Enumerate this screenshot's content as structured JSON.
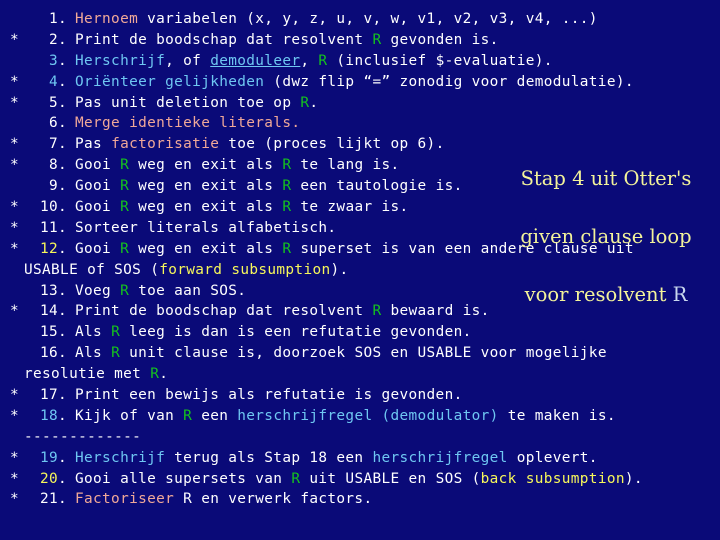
{
  "slide": {
    "background_color": "#0a0a78",
    "colors": {
      "white": "#ffffff",
      "green": "#14c21e",
      "blue": "#6fc7f2",
      "salmon": "#f0a898",
      "yellow": "#f7f75a",
      "annotation": "#f3f39a"
    }
  },
  "annotation": {
    "line1": "Stap 4 uit Otter's",
    "line2": "given clause loop",
    "line3": "voor resolvent ",
    "r": "R"
  },
  "steps": [
    {
      "mark": "",
      "number": "1",
      "dot": ".",
      "num_color": "w",
      "parts": [
        {
          "t": "",
          "c": "w"
        },
        {
          "t": "Hernoem",
          "c": "s"
        },
        {
          "t": " variabelen (x, y, z, u, v, w, v1, v2, v3, v4, ...)",
          "c": "w"
        }
      ]
    },
    {
      "mark": "*",
      "number": "2",
      "dot": ".",
      "num_color": "w",
      "parts": [
        {
          "t": "Print de boodschap dat resolvent ",
          "c": "w"
        },
        {
          "t": "R",
          "c": "g"
        },
        {
          "t": " gevonden is.",
          "c": "w"
        }
      ]
    },
    {
      "mark": "",
      "number": "3",
      "dot": ".",
      "num_color": "b",
      "parts": [
        {
          "t": "Herschrijf",
          "c": "b"
        },
        {
          "t": ", of ",
          "c": "w"
        },
        {
          "t": "demoduleer",
          "c": "b",
          "u": true
        },
        {
          "t": ", ",
          "c": "w"
        },
        {
          "t": "R",
          "c": "g"
        },
        {
          "t": " (inclusief $-evaluatie).",
          "c": "w"
        }
      ]
    },
    {
      "mark": "*",
      "number": "4",
      "dot": ".",
      "num_color": "b",
      "parts": [
        {
          "t": "Oriënteer gelijkheden",
          "c": "b"
        },
        {
          "t": " (dwz flip “=” zonodig voor demodulatie).",
          "c": "w"
        }
      ]
    },
    {
      "mark": "*",
      "number": "5",
      "dot": ".",
      "num_color": "w",
      "parts": [
        {
          "t": "Pas unit deletion toe op ",
          "c": "w"
        },
        {
          "t": "R",
          "c": "g"
        },
        {
          "t": ".",
          "c": "w"
        }
      ]
    },
    {
      "mark": "",
      "number": "6",
      "dot": ".",
      "num_color": "w",
      "parts": [
        {
          "t": "Merge identieke literals.",
          "c": "s"
        }
      ]
    },
    {
      "mark": "*",
      "number": "7",
      "dot": ".",
      "num_color": "w",
      "parts": [
        {
          "t": "Pas ",
          "c": "w"
        },
        {
          "t": "factorisatie",
          "c": "s"
        },
        {
          "t": " toe (proces lijkt op 6).",
          "c": "w"
        }
      ]
    },
    {
      "mark": "*",
      "number": "8",
      "dot": ".",
      "num_color": "w",
      "parts": [
        {
          "t": "Gooi ",
          "c": "w"
        },
        {
          "t": "R",
          "c": "g"
        },
        {
          "t": " weg en exit als ",
          "c": "w"
        },
        {
          "t": "R",
          "c": "g"
        },
        {
          "t": " te lang is.",
          "c": "w"
        }
      ]
    },
    {
      "mark": "",
      "number": "9",
      "dot": ".",
      "num_color": "w",
      "parts": [
        {
          "t": "Gooi ",
          "c": "w"
        },
        {
          "t": "R",
          "c": "g"
        },
        {
          "t": " weg en exit als ",
          "c": "w"
        },
        {
          "t": "R",
          "c": "g"
        },
        {
          "t": " een tautologie is.",
          "c": "w"
        }
      ]
    },
    {
      "mark": "*",
      "number": "10",
      "dot": ".",
      "num_color": "w",
      "parts": [
        {
          "t": "Gooi ",
          "c": "w"
        },
        {
          "t": "R",
          "c": "g"
        },
        {
          "t": " weg en exit als ",
          "c": "w"
        },
        {
          "t": "R",
          "c": "g"
        },
        {
          "t": " te zwaar is.",
          "c": "w"
        }
      ]
    },
    {
      "mark": "*",
      "number": "11",
      "dot": ".",
      "num_color": "w",
      "parts": [
        {
          "t": "Sorteer literals alfabetisch.",
          "c": "w"
        }
      ]
    },
    {
      "mark": "*",
      "number": "12",
      "dot": ".",
      "num_color": "y",
      "parts": [
        {
          "t": "Gooi ",
          "c": "w"
        },
        {
          "t": "R",
          "c": "g"
        },
        {
          "t": " weg en exit als ",
          "c": "w"
        },
        {
          "t": "R",
          "c": "g"
        },
        {
          "t": " superset is van een andere clause uit",
          "c": "w"
        }
      ]
    },
    {
      "continuation": true,
      "parts": [
        {
          "t": "USABLE of SOS (",
          "c": "w"
        },
        {
          "t": "forward subsumption",
          "c": "y"
        },
        {
          "t": ").",
          "c": "w"
        }
      ]
    },
    {
      "mark": "",
      "number": "13",
      "dot": ".",
      "num_color": "w",
      "parts": [
        {
          "t": "Voeg ",
          "c": "w"
        },
        {
          "t": "R",
          "c": "g"
        },
        {
          "t": " toe aan SOS.",
          "c": "w"
        }
      ]
    },
    {
      "mark": "*",
      "number": "14",
      "dot": ".",
      "num_color": "w",
      "parts": [
        {
          "t": "Print de boodschap dat resolvent ",
          "c": "w"
        },
        {
          "t": "R",
          "c": "g"
        },
        {
          "t": " bewaard is.",
          "c": "w"
        }
      ]
    },
    {
      "mark": "",
      "number": "15",
      "dot": ".",
      "num_color": "w",
      "parts": [
        {
          "t": "Als ",
          "c": "w"
        },
        {
          "t": "R",
          "c": "g"
        },
        {
          "t": " leeg is dan is een refutatie gevonden.",
          "c": "w"
        }
      ]
    },
    {
      "mark": "",
      "number": "16",
      "dot": ".",
      "num_color": "w",
      "parts": [
        {
          "t": "Als ",
          "c": "w"
        },
        {
          "t": "R",
          "c": "g"
        },
        {
          "t": " unit clause is, doorzoek SOS en USABLE voor mogelijke",
          "c": "w"
        }
      ]
    },
    {
      "continuation": true,
      "parts": [
        {
          "t": "resolutie met ",
          "c": "w"
        },
        {
          "t": "R",
          "c": "g"
        },
        {
          "t": ".",
          "c": "w"
        }
      ]
    },
    {
      "mark": "*",
      "number": "17",
      "dot": ".",
      "num_color": "w",
      "parts": [
        {
          "t": "Print een bewijs als refutatie is gevonden.",
          "c": "w"
        }
      ]
    },
    {
      "mark": "*",
      "number": "18",
      "dot": ".",
      "num_color": "b",
      "parts": [
        {
          "t": "Kijk of van ",
          "c": "w"
        },
        {
          "t": "R",
          "c": "g"
        },
        {
          "t": " een ",
          "c": "w"
        },
        {
          "t": "herschrijfregel",
          "c": "b"
        },
        {
          "t": " ",
          "c": "w"
        },
        {
          "t": "(demodulator)",
          "c": "b"
        },
        {
          "t": " te maken is.",
          "c": "w"
        }
      ]
    },
    {
      "continuation": true,
      "parts": [
        {
          "t": "-------------",
          "c": "w"
        }
      ]
    },
    {
      "mark": "*",
      "number": "19",
      "dot": ".",
      "num_color": "b",
      "parts": [
        {
          "t": "Herschrijf",
          "c": "b"
        },
        {
          "t": " terug als Stap 18 een ",
          "c": "w"
        },
        {
          "t": "herschrijfregel",
          "c": "b"
        },
        {
          "t": " oplevert.",
          "c": "w"
        }
      ]
    },
    {
      "mark": "*",
      "number": "20",
      "dot": ".",
      "num_color": "y",
      "parts": [
        {
          "t": "Gooi alle supersets van ",
          "c": "w"
        },
        {
          "t": "R",
          "c": "g"
        },
        {
          "t": " uit USABLE en SOS (",
          "c": "w"
        },
        {
          "t": "back subsumption",
          "c": "y"
        },
        {
          "t": ").",
          "c": "w"
        }
      ]
    },
    {
      "mark": "*",
      "number": "21",
      "dot": ".",
      "num_color": "w",
      "parts": [
        {
          "t": "Factoriseer",
          "c": "s"
        },
        {
          "t": " R en verwerk factors.",
          "c": "w"
        }
      ]
    }
  ]
}
